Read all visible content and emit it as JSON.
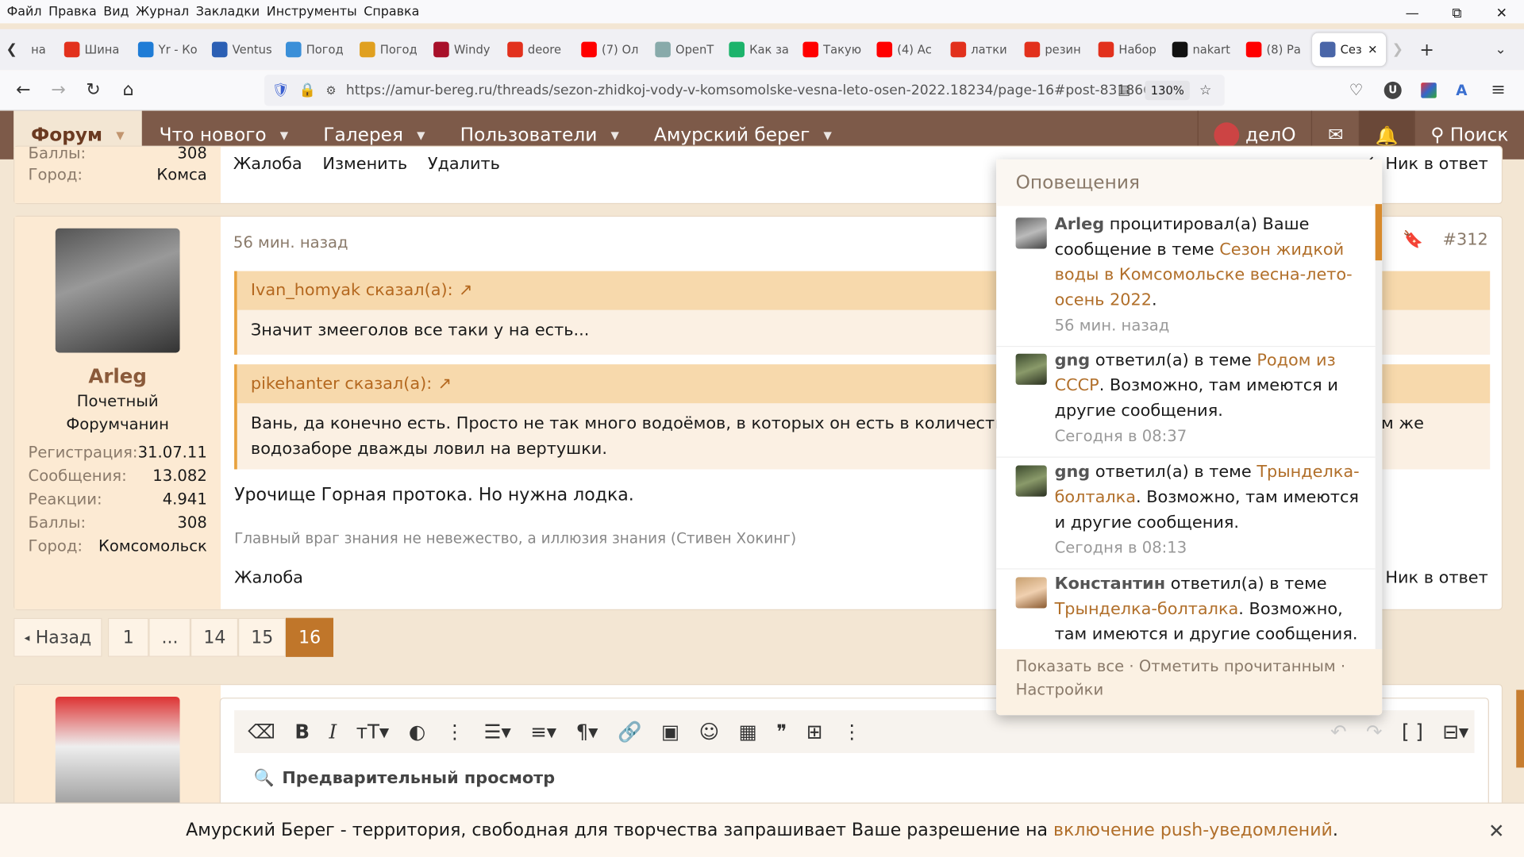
{
  "menubar": {
    "items": [
      "Файл",
      "Правка",
      "Вид",
      "Журнал",
      "Закладки",
      "Инструменты",
      "Справка"
    ]
  },
  "window_controls": {
    "minimize": "—",
    "restore": "⧉",
    "close": "✕"
  },
  "tabs": [
    {
      "label": "на",
      "color": "#cccccc"
    },
    {
      "label": "Шина",
      "color": "#e2311d"
    },
    {
      "label": "Yr - Ко",
      "color": "#1f7cd6"
    },
    {
      "label": "Ventus",
      "color": "#2b5fb4"
    },
    {
      "label": "Погод",
      "color": "#3a8fd8"
    },
    {
      "label": "Погод",
      "color": "#e0a020"
    },
    {
      "label": "Windy",
      "color": "#a8102a"
    },
    {
      "label": "deore",
      "color": "#e2311d"
    },
    {
      "label": "(7) Ол",
      "color": "#ff0000"
    },
    {
      "label": "OpenT",
      "color": "#8aa"
    },
    {
      "label": "Как за",
      "color": "#1cb36b"
    },
    {
      "label": "Такую",
      "color": "#ff0000"
    },
    {
      "label": "(4) Ас",
      "color": "#ff0000"
    },
    {
      "label": "латки",
      "color": "#e2311d"
    },
    {
      "label": "резин",
      "color": "#e2311d"
    },
    {
      "label": "Набор",
      "color": "#e2311d"
    },
    {
      "label": "nakart",
      "color": "#111111"
    },
    {
      "label": "(8) Ра",
      "color": "#ff0000"
    },
    {
      "label": "Сез",
      "color": "#4a66a8",
      "active": true
    }
  ],
  "tab_close": "✕",
  "tab_new": "+",
  "url": "https://amur-bereg.ru/threads/sezon-zhidkoj-vody-v-komsomolske-vesna-leto-osen-2022.18234/page-16#post-831866",
  "zoom": "130%",
  "forum_nav": {
    "items": [
      {
        "label": "Форум",
        "active": true
      },
      {
        "label": "Что нового"
      },
      {
        "label": "Галерея"
      },
      {
        "label": "Пользователи"
      },
      {
        "label": "Амурский берег"
      }
    ],
    "username": "делО",
    "search": "Поиск"
  },
  "prev_post": {
    "stats_partial": [
      {
        "label": "Баллы:",
        "value": "308"
      },
      {
        "label": "Город:",
        "value": "Комса"
      }
    ],
    "actions": [
      "Жалоба",
      "Изменить",
      "Удалить"
    ],
    "reply_nick": "Ник в ответ"
  },
  "post": {
    "time": "56 мин. назад",
    "number": "#312",
    "author": "Arleg",
    "rank_line1": "Почетный",
    "rank_line2": "Форумчанин",
    "stats": [
      {
        "label": "Регистрация:",
        "value": "31.07.11"
      },
      {
        "label": "Сообщения:",
        "value": "13.082"
      },
      {
        "label": "Реакции:",
        "value": "4.941"
      },
      {
        "label": "Баллы:",
        "value": "308"
      },
      {
        "label": "Город:",
        "value": "Комсомольск"
      }
    ],
    "quote1": {
      "header": "Ivan_homyak сказал(а):",
      "text": "Значит змееголов все таки у на есть..."
    },
    "quote2": {
      "header": "pikehanter сказал(а):",
      "text_line1_left": "Вань, да конечно есть. Просто не так много водоёмов, в которых он есть в количестве, в с",
      "text_line1_right": "ом же",
      "text_line2": "водозаборе дважды ловил на вертушки."
    },
    "text": "Урочище Горная протока. Но нужна лодка.",
    "signature": "Главный враг знания не невежество, а иллюзия знания (Стивен Хокинг)",
    "action": "Жалоба",
    "reply_nick": "Ник в ответ"
  },
  "pager": {
    "back": "Назад",
    "pages": [
      "1",
      "...",
      "14",
      "15",
      "16"
    ],
    "current": "16"
  },
  "editor": {
    "preview": "Предварительный просмотр"
  },
  "notifications": {
    "title": "Оповещения",
    "items": [
      {
        "user": "Arleg",
        "action": "процитировал(а) Ваше сообщение в теме",
        "thread": "Сезон жидкой воды в Комсомольске весна-лето-осень 2022",
        "tail": ".",
        "time": "56 мин. назад"
      },
      {
        "user": "gng",
        "action": "ответил(а) в теме",
        "thread": "Родом из СССР",
        "tail": ". Возможно, там имеются и другие сообщения.",
        "time": "Сегодня в 08:37"
      },
      {
        "user": "gng",
        "action": "ответил(а) в теме",
        "thread": "Трынделка-болталка",
        "tail": ". Возможно, там имеются и другие сообщения.",
        "time": "Сегодня в 08:13"
      },
      {
        "user": "Константин",
        "action": "ответил(а) в теме",
        "thread": "Трынделка-болталка",
        "tail": ". Возможно, там имеются и другие сообщения.",
        "time": ""
      }
    ],
    "footer_show_all": "Показать все",
    "footer_mark_read": "Отметить прочитанным",
    "footer_settings": "Настройки"
  },
  "push_bar": {
    "text": "Амурский Берег - территория, свободная для творчества запрашивает Ваше разрешение на ",
    "link": "включение push-уведомлений",
    "tail": ".",
    "close": "✕"
  }
}
